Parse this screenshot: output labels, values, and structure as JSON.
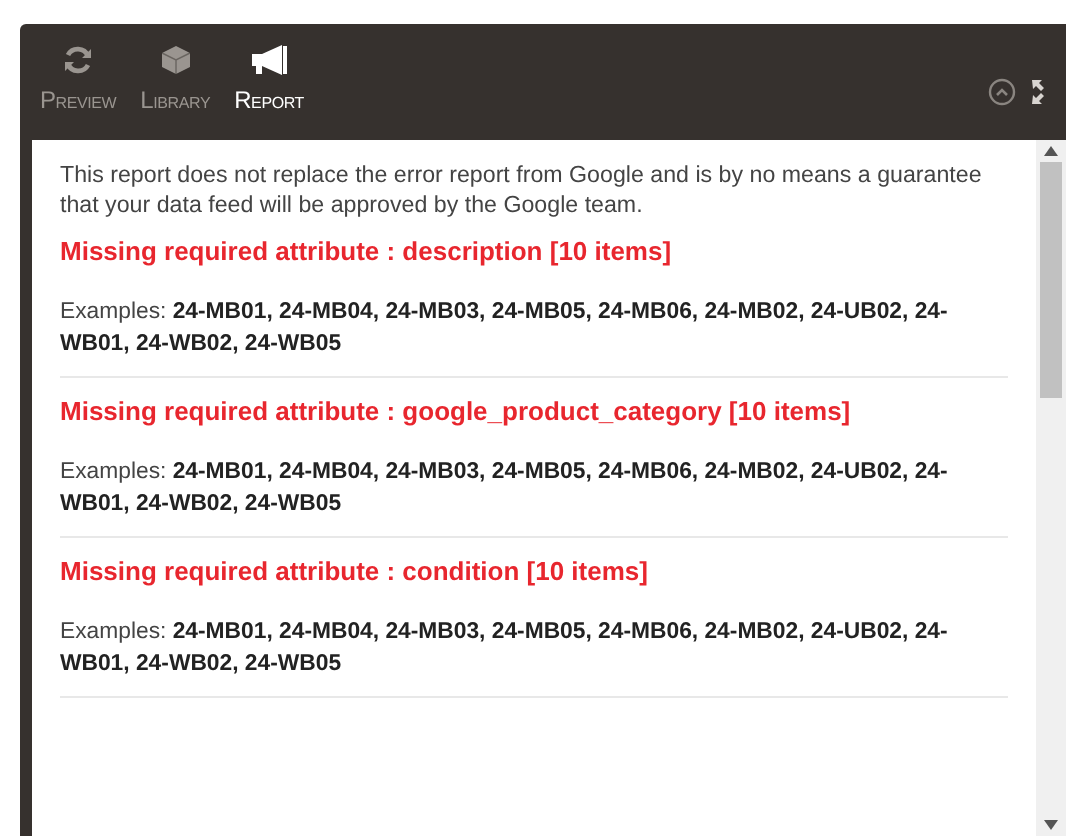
{
  "toolbar": {
    "tabs": [
      {
        "label": "Preview",
        "kind": "refresh",
        "selected": false
      },
      {
        "label": "Library",
        "kind": "cube",
        "selected": false
      },
      {
        "label": "Report",
        "kind": "megaphone",
        "selected": true
      }
    ]
  },
  "disclaimer": "This report does not replace the error report from Google and is by no means a guarantee that your data feed will be approved by the Google team.",
  "issues": [
    {
      "title": "Missing required attribute : description [10 items]",
      "examples": "Examples: **24-MB01, 24-MB04, 24-MB03, 24-MB05, 24-MB06, 24-MB02, 24-UB02, 24-WB01, 24-WB02, 24-WB05**"
    },
    {
      "title": "Missing required attribute : google_product_category [10 items]",
      "examples": "Examples: **24-MB01, 24-MB04, 24-MB03, 24-MB05, 24-MB06, 24-MB02, 24-UB02, 24-WB01, 24-WB02, 24-WB05**"
    },
    {
      "title": "Missing required attribute : condition [10 items]",
      "examples": "Examples: **24-MB01, 24-MB04, 24-MB03, 24-MB05, 24-MB06, 24-MB02, 24-UB02, 24-WB01, 24-WB02, 24-WB05**"
    }
  ]
}
